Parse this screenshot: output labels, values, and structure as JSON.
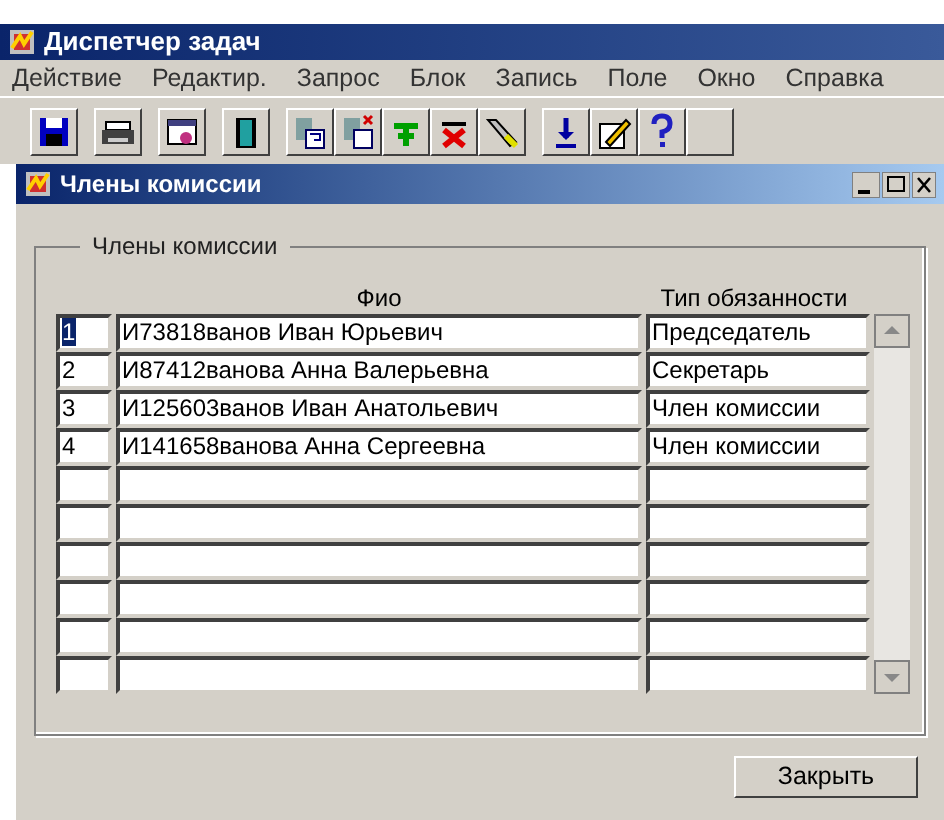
{
  "app_window": {
    "title": "Диспетчер задач"
  },
  "menu": [
    "Действие",
    "Редактир.",
    "Запрос",
    "Блок",
    "Запись",
    "Поле",
    "Окно",
    "Справка"
  ],
  "form_window": {
    "title": "Члены комиссии"
  },
  "group": {
    "title": "Члены комиссии"
  },
  "table": {
    "columns": [
      "Фио",
      "Тип обязанности"
    ],
    "rows": [
      {
        "number": "1",
        "name": "И73818ванов Иван Юрьевич",
        "role": "Председатель",
        "selected": true
      },
      {
        "number": "2",
        "name": "И87412ванова Анна Валерьевна",
        "role": "Секретарь",
        "selected": false
      },
      {
        "number": "3",
        "name": "И125603ванов Иван Анатольевич",
        "role": "Член комиссии",
        "selected": false
      },
      {
        "number": "4",
        "name": "И141658ванова Анна Сергеевна",
        "role": "Член комиссии",
        "selected": false
      }
    ]
  },
  "buttons": [
    "Закрыть"
  ]
}
